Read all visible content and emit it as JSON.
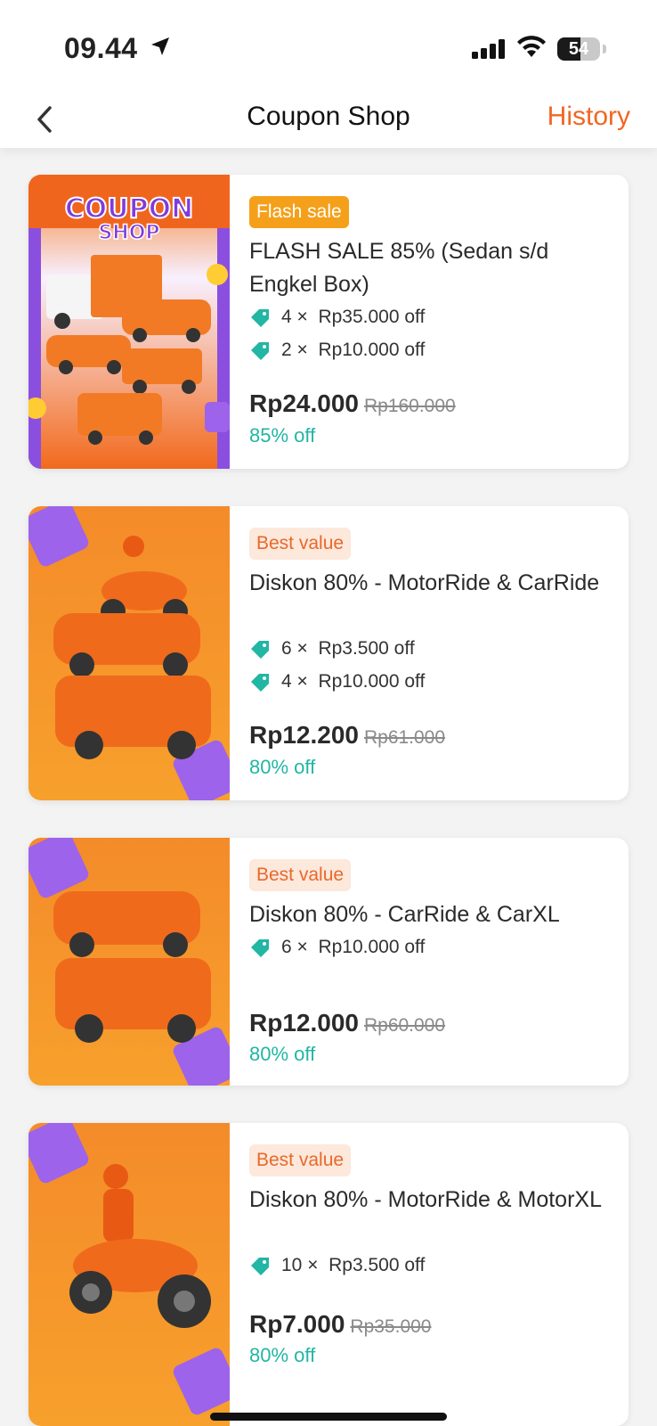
{
  "status_bar": {
    "time": "09.44",
    "battery": "54",
    "battery_level": 0.54
  },
  "nav": {
    "title": "Coupon Shop",
    "history": "History"
  },
  "colors": {
    "accent": "#f16622",
    "discount": "#22b6a4",
    "flash_badge": "#f5a01a",
    "best_badge_bg": "#fde8dc",
    "purple": "#8b4fe0"
  },
  "coupons": [
    {
      "badge": "Flash sale",
      "badge_type": "flash",
      "title": "FLASH SALE 85% (Sedan s/d Engkel Box)",
      "perks": [
        {
          "count": "4 ×",
          "amount": "Rp35.000 off"
        },
        {
          "count": "2 ×",
          "amount": "Rp10.000 off"
        }
      ],
      "price": "Rp24.000",
      "original_price": "Rp160.000",
      "discount": "85% off",
      "image_banner": [
        "COUPON",
        "SHOP"
      ]
    },
    {
      "badge": "Best value",
      "badge_type": "best",
      "title": "Diskon 80% - MotorRide & CarRide",
      "perks": [
        {
          "count": "6 ×",
          "amount": "Rp3.500 off"
        },
        {
          "count": "4 ×",
          "amount": "Rp10.000 off"
        }
      ],
      "price": "Rp12.200",
      "original_price": "Rp61.000",
      "discount": "80% off"
    },
    {
      "badge": "Best value",
      "badge_type": "best",
      "title": "Diskon 80% - CarRide & CarXL",
      "perks": [
        {
          "count": "6 ×",
          "amount": "Rp10.000 off"
        }
      ],
      "price": "Rp12.000",
      "original_price": "Rp60.000",
      "discount": "80% off"
    },
    {
      "badge": "Best value",
      "badge_type": "best",
      "title": "Diskon 80% - MotorRide & MotorXL",
      "perks": [
        {
          "count": "10 ×",
          "amount": "Rp3.500 off"
        }
      ],
      "price": "Rp7.000",
      "original_price": "Rp35.000",
      "discount": "80% off"
    }
  ]
}
